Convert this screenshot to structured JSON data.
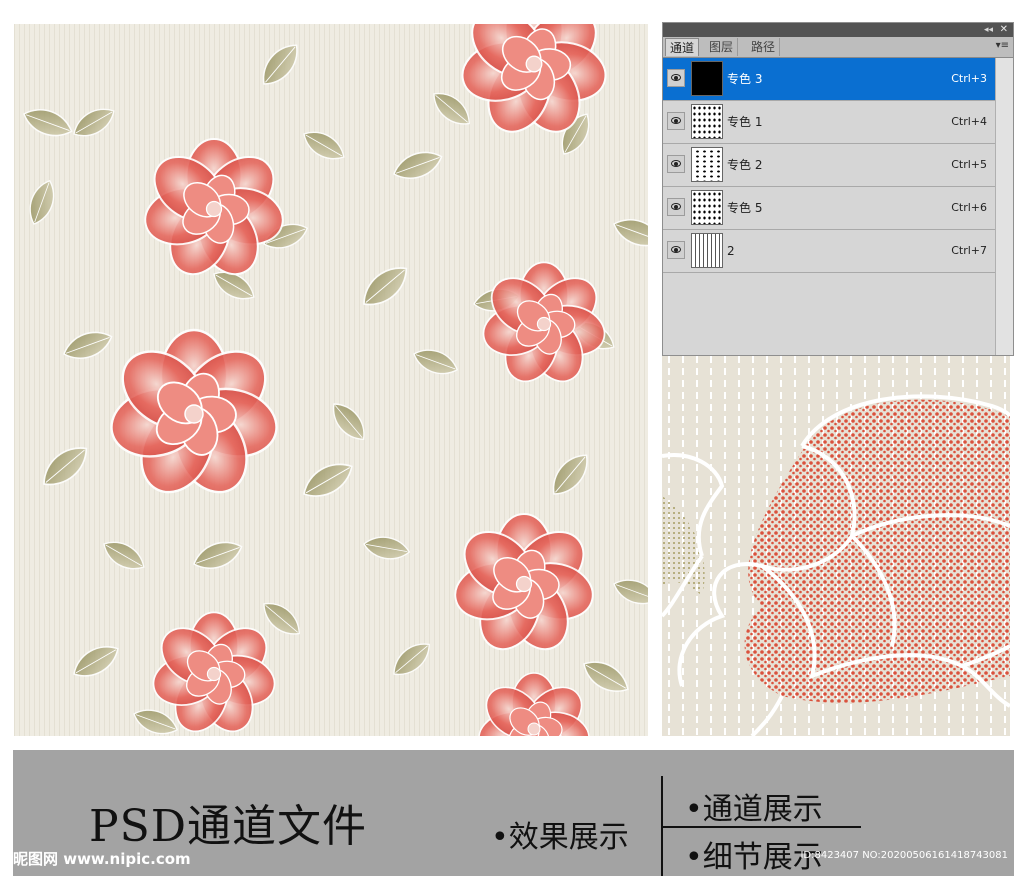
{
  "panel": {
    "tabs": [
      "通道",
      "图层",
      "路径"
    ],
    "collapse_glyph": "◂◂",
    "close_glyph": "✕",
    "menu_glyph": "▾≡",
    "channels": [
      {
        "name": "专色 3",
        "shortcut": "Ctrl+3",
        "thumb": "black",
        "selected": true
      },
      {
        "name": "专色 1",
        "shortcut": "Ctrl+4",
        "thumb": "dots",
        "selected": false
      },
      {
        "name": "专色 2",
        "shortcut": "Ctrl+5",
        "thumb": "dots2",
        "selected": false
      },
      {
        "name": "专色 5",
        "shortcut": "Ctrl+6",
        "thumb": "dots",
        "selected": false
      },
      {
        "name": "2",
        "shortcut": "Ctrl+7",
        "thumb": "stripes",
        "selected": false
      }
    ]
  },
  "banner": {
    "title": "PSD通道文件",
    "effect_label": "•效果展示",
    "channel_label": "•通道展示",
    "detail_label": "•细节展示",
    "watermark_left": "昵图网 www.nipic.com",
    "watermark_right": "ID:8423407 NO:20200506161418743081"
  },
  "colors": {
    "background_cream": "#efece2",
    "flower_red": "#e0625a",
    "leaf_olive": "#a39a62",
    "selection_blue": "#0a6fd1",
    "banner_gray": "#a3a3a3"
  }
}
